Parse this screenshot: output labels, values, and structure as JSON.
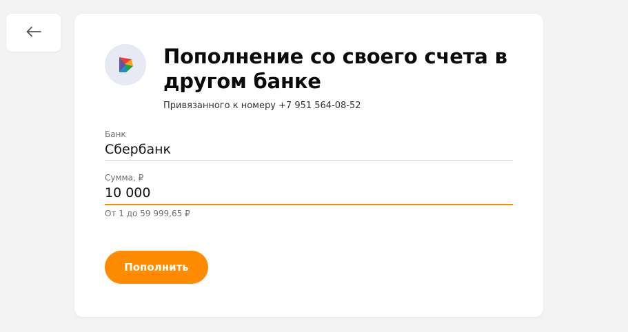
{
  "colors": {
    "accent": "#ff8c00",
    "page_background": "#f3f3f3",
    "card_background": "#ffffff",
    "logo_background": "#e7e9f4"
  },
  "icons": {
    "back": "arrow-left-icon",
    "bank": "sbp-logo-icon"
  },
  "header": {
    "title": "Пополнение со своего счета в другом банке",
    "subtitle": "Привязанного к номеру +7 951 564-08-52"
  },
  "form": {
    "bank": {
      "label": "Банк",
      "value": "Сбербанк"
    },
    "amount": {
      "label": "Сумма, ₽",
      "value": "10 000",
      "hint": "От 1 до 59 999,65 ₽"
    },
    "submit_label": "Пополнить"
  }
}
